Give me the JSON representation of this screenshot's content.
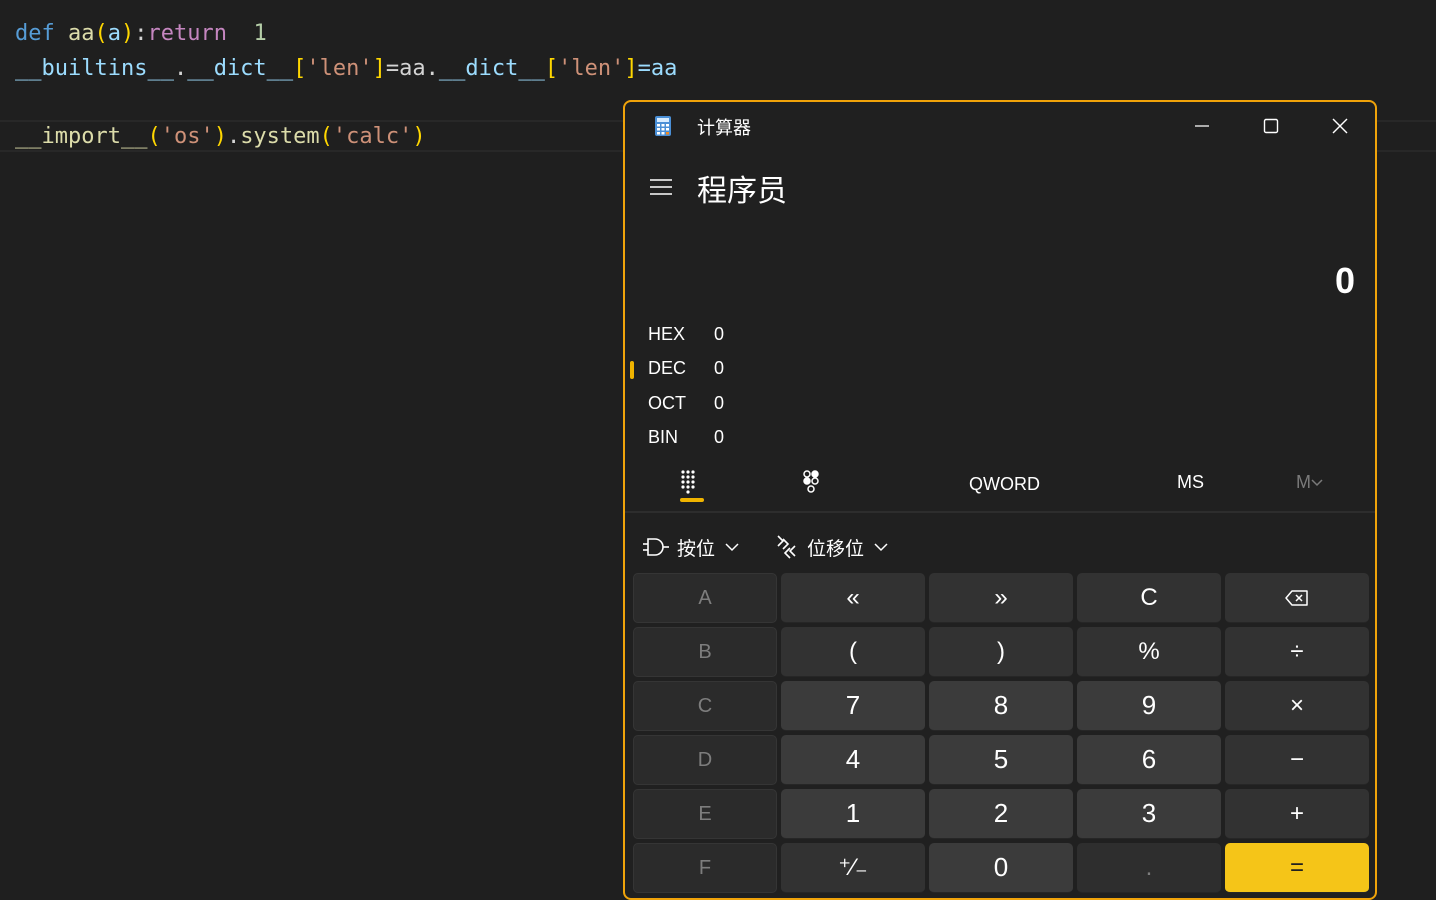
{
  "editor": {
    "lines": [
      [
        {
          "t": "def",
          "c": "kw"
        },
        {
          "t": " ",
          "c": "plain"
        },
        {
          "t": "aa",
          "c": "fn"
        },
        {
          "t": "(",
          "c": "br1"
        },
        {
          "t": "a",
          "c": "var"
        },
        {
          "t": ")",
          "c": "br1"
        },
        {
          "t": ":",
          "c": "plain"
        },
        {
          "t": "return",
          "c": "kw2"
        },
        {
          "t": "  ",
          "c": "plain"
        },
        {
          "t": "1",
          "c": "num"
        }
      ],
      [
        {
          "t": "__builtins__",
          "c": "var"
        },
        {
          "t": ".",
          "c": "plain"
        },
        {
          "t": "__dict__",
          "c": "var"
        },
        {
          "t": "[",
          "c": "br1"
        },
        {
          "t": "'len'",
          "c": "str"
        },
        {
          "t": "]",
          "c": "br1"
        },
        {
          "t": "=aa.",
          "c": "plain"
        },
        {
          "t": "__dict__",
          "c": "var"
        },
        {
          "t": "[",
          "c": "br1"
        },
        {
          "t": "'len'",
          "c": "str"
        },
        {
          "t": "]",
          "c": "br1"
        },
        {
          "t": "=aa",
          "c": "var"
        }
      ],
      [],
      [
        {
          "t": "__import__",
          "c": "fn"
        },
        {
          "t": "(",
          "c": "br1"
        },
        {
          "t": "'os'",
          "c": "str"
        },
        {
          "t": ")",
          "c": "br1"
        },
        {
          "t": ".",
          "c": "plain"
        },
        {
          "t": "system",
          "c": "fn"
        },
        {
          "t": "(",
          "c": "br1"
        },
        {
          "t": "'calc'",
          "c": "str"
        },
        {
          "t": ")",
          "c": "br1"
        }
      ]
    ]
  },
  "calculator": {
    "window_title": "计算器",
    "mode_title": "程序员",
    "display": "0",
    "radix": [
      {
        "label": "HEX",
        "value": "0"
      },
      {
        "label": "DEC",
        "value": "0"
      },
      {
        "label": "OCT",
        "value": "0"
      },
      {
        "label": "BIN",
        "value": "0"
      }
    ],
    "selected_radix": "DEC",
    "word_size": "QWORD",
    "memory_store": "MS",
    "memory_list": "M",
    "bitwise_label": "按位",
    "bitshift_label": "位移位",
    "accent_color": "#f0b400",
    "keys": [
      [
        {
          "l": "A",
          "k": "hex"
        },
        {
          "l": "«",
          "k": "op"
        },
        {
          "l": "»",
          "k": "op"
        },
        {
          "l": "C",
          "k": "op"
        },
        {
          "l": "backspace-icon",
          "k": "op",
          "icon": true
        }
      ],
      [
        {
          "l": "B",
          "k": "hex"
        },
        {
          "l": "(",
          "k": "op"
        },
        {
          "l": ")",
          "k": "op"
        },
        {
          "l": "%",
          "k": "op"
        },
        {
          "l": "÷",
          "k": "op"
        }
      ],
      [
        {
          "l": "C",
          "k": "hex"
        },
        {
          "l": "7",
          "k": "num"
        },
        {
          "l": "8",
          "k": "num"
        },
        {
          "l": "9",
          "k": "num"
        },
        {
          "l": "×",
          "k": "op"
        }
      ],
      [
        {
          "l": "D",
          "k": "hex"
        },
        {
          "l": "4",
          "k": "num"
        },
        {
          "l": "5",
          "k": "num"
        },
        {
          "l": "6",
          "k": "num"
        },
        {
          "l": "−",
          "k": "op"
        }
      ],
      [
        {
          "l": "E",
          "k": "hex"
        },
        {
          "l": "1",
          "k": "num"
        },
        {
          "l": "2",
          "k": "num"
        },
        {
          "l": "3",
          "k": "num"
        },
        {
          "l": "+",
          "k": "op"
        }
      ],
      [
        {
          "l": "F",
          "k": "hex"
        },
        {
          "l": "⁺∕₋",
          "k": "op"
        },
        {
          "l": "0",
          "k": "num"
        },
        {
          "l": ".",
          "k": "dis"
        },
        {
          "l": "=",
          "k": "eq"
        }
      ]
    ]
  }
}
